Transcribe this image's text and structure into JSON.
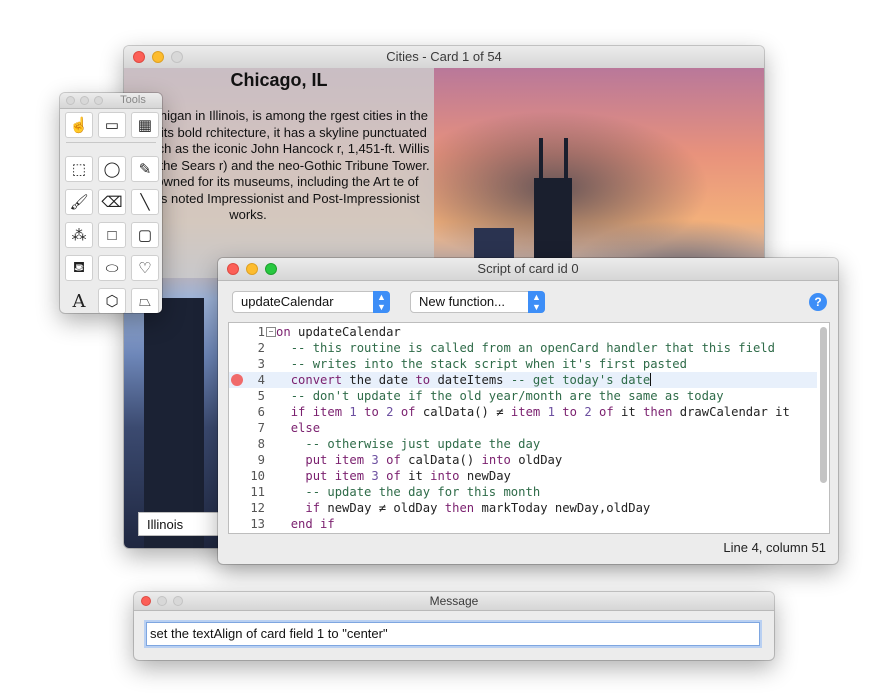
{
  "cities_window": {
    "title": "Cities - Card 1 of 54",
    "city_title": "Chicago, IL",
    "description": "go, on Lake Michigan in Illinois, is among the rgest cities in the U.S. Famed for its bold rchitecture, it has a skyline punctuated by yscrapers such as the iconic John Hancock r, 1,451-ft. Willis Tower (formerly the Sears r) and the neo-Gothic Tribune Tower. The city o renowned for its museums, including the Art te of Chicago with its noted Impressionist and Post-Impressionist works.",
    "state_field": "Illinois"
  },
  "tools_palette": {
    "title": "Tools",
    "tools": [
      {
        "name": "browse-tool-icon",
        "glyph": "☝"
      },
      {
        "name": "button-tool-icon",
        "glyph": "▭"
      },
      {
        "name": "field-tool-icon",
        "glyph": "▦"
      },
      {
        "name": "select-tool-icon",
        "glyph": "⬚"
      },
      {
        "name": "lasso-tool-icon",
        "glyph": "◯"
      },
      {
        "name": "pencil-tool-icon",
        "glyph": "✎"
      },
      {
        "name": "brush-tool-icon",
        "glyph": "🖌"
      },
      {
        "name": "eraser-tool-icon",
        "glyph": "⌫"
      },
      {
        "name": "line-tool-icon",
        "glyph": "╲"
      },
      {
        "name": "spray-tool-icon",
        "glyph": "⁂"
      },
      {
        "name": "rectangle-tool-icon",
        "glyph": "□"
      },
      {
        "name": "rounded-rect-tool-icon",
        "glyph": "▢"
      },
      {
        "name": "bucket-tool-icon",
        "glyph": "⛾"
      },
      {
        "name": "oval-tool-icon",
        "glyph": "⬭"
      },
      {
        "name": "curve-tool-icon",
        "glyph": "♡"
      },
      {
        "name": "text-tool-icon",
        "glyph": "A"
      },
      {
        "name": "polygon-tool-icon",
        "glyph": "⬡"
      },
      {
        "name": "freeform-polygon-tool-icon",
        "glyph": "⏢"
      }
    ]
  },
  "script_editor": {
    "title": "Script of card id 0",
    "handler_popup": "updateCalendar",
    "function_popup": "New function...",
    "help_label": "?",
    "status": "Line 4, column 51",
    "lines": [
      {
        "n": "1",
        "html": "<span class=\"kw\">on</span> updateCalendar"
      },
      {
        "n": "2",
        "html": "  <span class=\"cm\">-- this routine is called from an openCard handler that this field</span>"
      },
      {
        "n": "3",
        "html": "  <span class=\"cm\">-- writes into the stack script when it's first pasted</span>"
      },
      {
        "n": "4",
        "html": "  <span class=\"kw\">convert</span> the date <span class=\"kw\">to</span> dateItems <span class=\"cm\">-- get today's date</span><span class=\"caret\"></span>"
      },
      {
        "n": "5",
        "html": "  <span class=\"cm\">-- don't update if the old year/month are the same as today</span>"
      },
      {
        "n": "6",
        "html": "  <span class=\"kw\">if</span> <span class=\"kw\">item</span> <span class=\"num\">1</span> <span class=\"kw\">to</span> <span class=\"num\">2</span> <span class=\"kw\">of</span> calData() ≠ <span class=\"kw\">item</span> <span class=\"num\">1</span> <span class=\"kw\">to</span> <span class=\"num\">2</span> <span class=\"kw\">of</span> it <span class=\"kw\">then</span> drawCalendar it"
      },
      {
        "n": "7",
        "html": "  <span class=\"kw\">else</span>"
      },
      {
        "n": "8",
        "html": "    <span class=\"cm\">-- otherwise just update the day</span>"
      },
      {
        "n": "9",
        "html": "    <span class=\"kw\">put</span> <span class=\"kw\">item</span> <span class=\"num\">3</span> <span class=\"kw\">of</span> calData() <span class=\"kw\">into</span> oldDay"
      },
      {
        "n": "10",
        "html": "    <span class=\"kw\">put</span> <span class=\"kw\">item</span> <span class=\"num\">3</span> <span class=\"kw\">of</span> it <span class=\"kw\">into</span> newDay"
      },
      {
        "n": "11",
        "html": "    <span class=\"cm\">-- update the day for this month</span>"
      },
      {
        "n": "12",
        "html": "    <span class=\"kw\">if</span> newDay ≠ oldDay <span class=\"kw\">then</span> markToday newDay,oldDay"
      },
      {
        "n": "13",
        "html": "  <span class=\"kw\">end if</span>"
      }
    ]
  },
  "message_box": {
    "title": "Message",
    "input_value": "set the textAlign of card field 1 to \"center\""
  }
}
